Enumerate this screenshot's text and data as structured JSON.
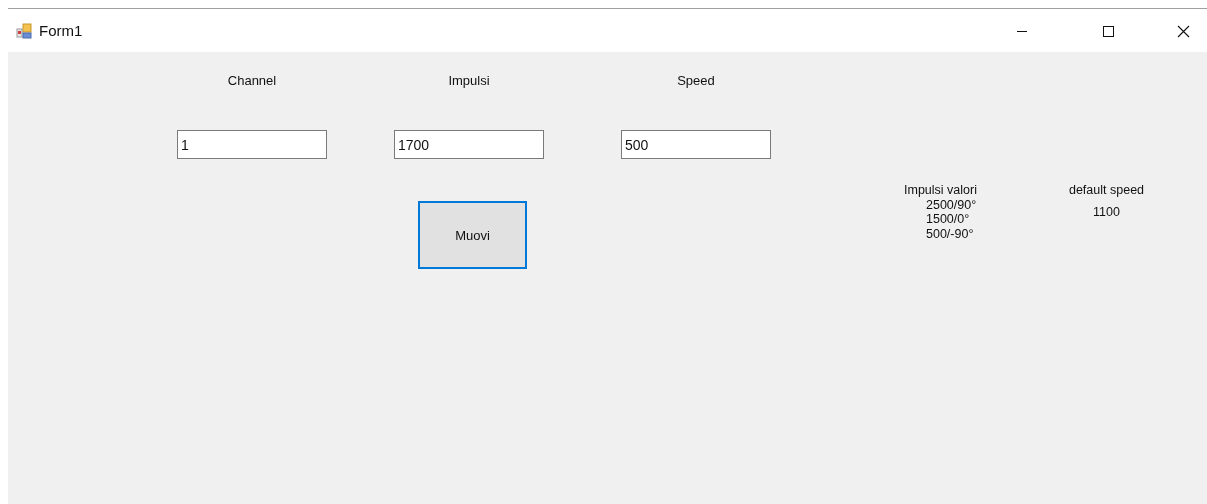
{
  "window": {
    "title": "Form1"
  },
  "fields": [
    {
      "label": "Channel",
      "value": "1"
    },
    {
      "label": "Impulsi",
      "value": "1700"
    },
    {
      "label": "Speed",
      "value": "500"
    }
  ],
  "button": {
    "label": "Muovi",
    "focused": true
  },
  "info": [
    {
      "title": "Impulsi valori",
      "lines": [
        "2500/90°",
        "1500/0°",
        "500/-90°"
      ]
    },
    {
      "title": "default speed",
      "lines": [
        "1100"
      ]
    }
  ]
}
